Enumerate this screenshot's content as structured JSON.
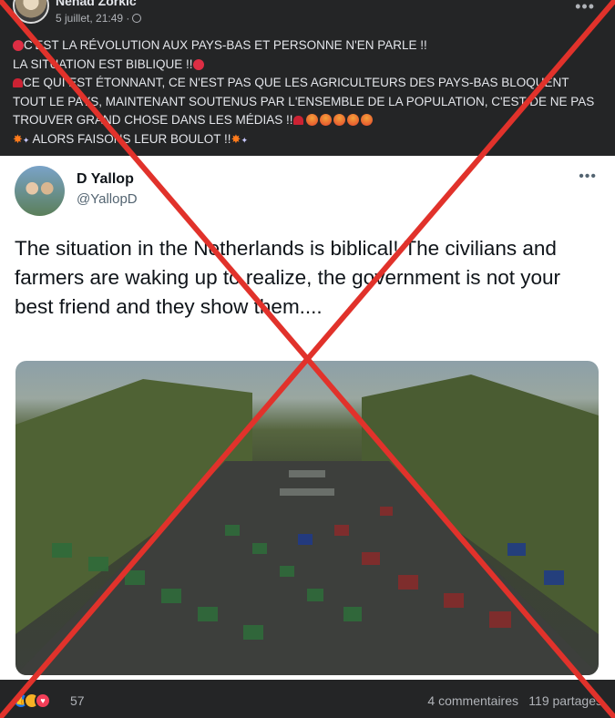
{
  "post": {
    "author": "Nenad Zorkic",
    "date": "5 juillet, 21:49 ·",
    "more": "•••",
    "lines": {
      "l1": "C'EST LA RÉVOLUTION AUX PAYS-BAS ET PERSONNE N'EN PARLE !!",
      "l2": "LA SITUATION EST BIBLIQUE !!",
      "l3": "CE QUI EST ÉTONNANT, CE N'EST PAS QUE LES AGRICULTEURS DES PAYS-BAS BLOQUENT",
      "l4": "TOUT LE PAYS, MAINTENANT SOUTENUS PAR L'ENSEMBLE DE LA POPULATION, C'EST DE NE PAS",
      "l5": "TROUVER GRAND CHOSE DANS LES MÉDIAS !!",
      "l6": "ALORS FAISONS LEUR BOULOT !!"
    }
  },
  "tweet": {
    "name": "D Yallop",
    "handle": "@YallopD",
    "more": "•••",
    "text": "The situation in the Netherlands is biblical! The civilians and farmers are waking up to realize, the government is not your best friend and they show them...."
  },
  "footer": {
    "reaction_count": "57",
    "comments": "4 commentaires",
    "shares": "119 partages"
  },
  "colors": {
    "background": "#242526",
    "overlay_x": "#e1322b",
    "text": "#e4e6eb",
    "muted": "#b0b3b8"
  },
  "icons": [
    "globe-icon",
    "like-icon",
    "haha-icon",
    "love-icon",
    "siren-icon",
    "angry-face-icon",
    "collision-icon",
    "red-circle-icon"
  ]
}
